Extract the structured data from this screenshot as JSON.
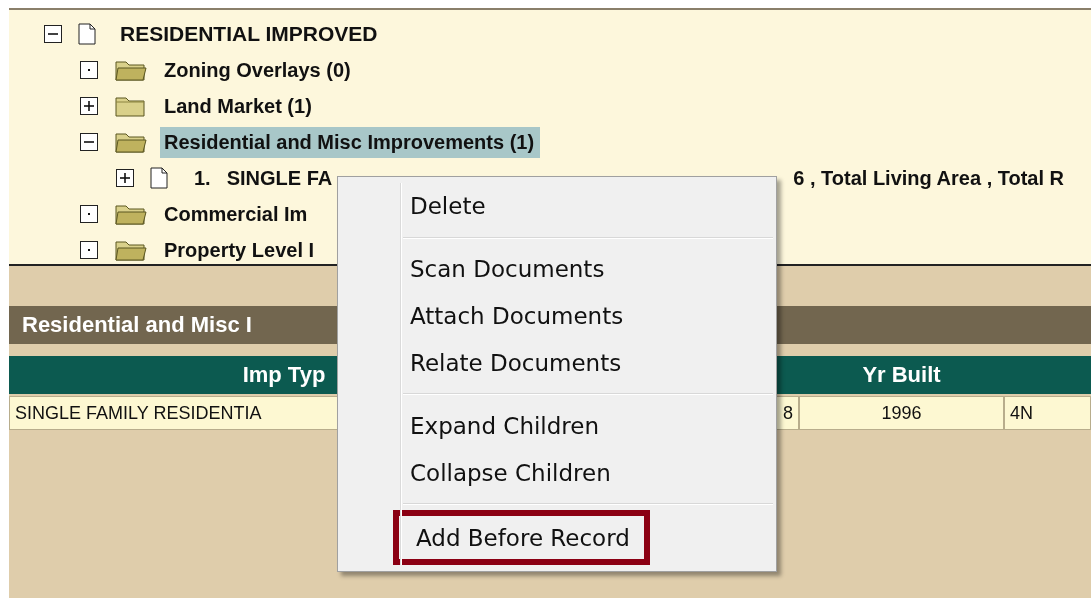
{
  "tree": [
    {
      "label": "RESIDENTIAL IMPROVED",
      "kind": "document",
      "expanded": true,
      "has_children": true,
      "selected": false,
      "children": [
        {
          "label": "Zoning Overlays (0)",
          "kind": "folder",
          "has_children": false,
          "selected": false
        },
        {
          "label": "Land Market (1)",
          "kind": "folder",
          "expanded": false,
          "has_children": true,
          "selected": false
        },
        {
          "label": "Residential and Misc Improvements (1)",
          "kind": "folder",
          "expanded": true,
          "has_children": true,
          "selected": true,
          "children": [
            {
              "number": "1.",
              "label": "SINGLE FA",
              "label_after": "6 , Total Living Area , Total R",
              "kind": "document",
              "expanded": false,
              "has_children": true,
              "selected": false
            }
          ]
        },
        {
          "label": "Commercial Im",
          "kind": "folder",
          "has_children": false,
          "selected": false
        },
        {
          "label": "Property Level I",
          "kind": "folder",
          "has_children": false,
          "selected": false
        }
      ]
    }
  ],
  "section_title": "Residential and Misc I",
  "table": {
    "headers": [
      "Imp Typ",
      "Yr Built"
    ],
    "rows": [
      [
        "SINGLE FAMILY RESIDENTIA",
        "8",
        "1996",
        "4N"
      ]
    ]
  },
  "context_menu": {
    "groups": [
      [
        {
          "label": "Delete",
          "outlined": false
        }
      ],
      [
        {
          "label": "Scan Documents",
          "outlined": false
        },
        {
          "label": "Attach Documents",
          "outlined": false
        },
        {
          "label": "Relate Documents",
          "outlined": false
        }
      ],
      [
        {
          "label": "Expand Children",
          "outlined": false
        },
        {
          "label": "Collapse Children",
          "outlined": false
        }
      ],
      [
        {
          "label": "Add Before Record",
          "outlined": true
        }
      ]
    ]
  }
}
